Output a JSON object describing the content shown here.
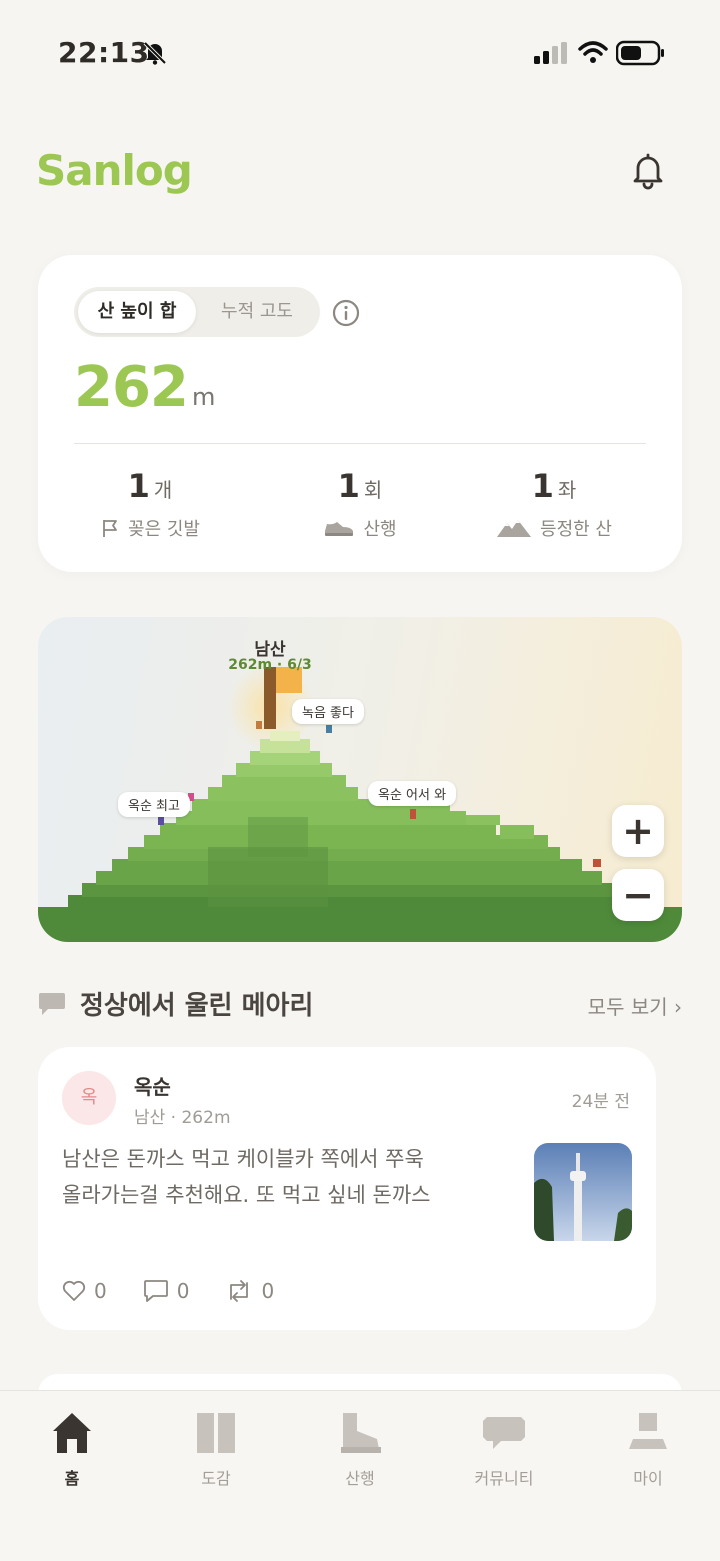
{
  "status_bar": {
    "time": "22:13"
  },
  "header": {
    "app_title": "Sanlog",
    "notification_icon": "bell-icon"
  },
  "stats": {
    "segment_active": "산 높이 합",
    "segment_inactive": "누적 고도",
    "total_value": "262",
    "total_unit": "m",
    "items": [
      {
        "value": "1",
        "unit": "개",
        "label": "꽂은 깃발",
        "icon": "flag-icon"
      },
      {
        "value": "1",
        "unit": "회",
        "label": "산행",
        "icon": "shoe-icon"
      },
      {
        "value": "1",
        "unit": "좌",
        "label": "등정한 산",
        "icon": "mountain-icon"
      }
    ]
  },
  "mountain": {
    "peak_name": "남산",
    "peak_meta": "262m · 6/3",
    "bubbles": [
      "녹음 좋다",
      "옥순 최고",
      "옥순 어서 와"
    ],
    "zoom_in": "+",
    "zoom_out": "−",
    "colors": {
      "grass_light": "#8cc160",
      "grass_mid": "#6aa448",
      "grass_dark": "#4f8a3a",
      "flag": "#f4b24a"
    }
  },
  "memos_section": {
    "title": "정상에서 울린 메아리",
    "see_all": "모두 보기 ›"
  },
  "memo": {
    "avatar_text": "옥",
    "author": "옥순",
    "sub": "남산 · 262m",
    "time": "24분 전",
    "text_line1": "남산은 돈까스 먹고 케이블카 쪽에서 쭈욱",
    "text_line2": "올라가는걸 추천해요. 또 먹고 싶네 돈까스",
    "likes": "0",
    "comments": "0",
    "reposts": "0"
  },
  "tabs": [
    {
      "label": "홈",
      "icon": "home-icon",
      "active": true
    },
    {
      "label": "도감",
      "icon": "book-icon",
      "active": false
    },
    {
      "label": "산행",
      "icon": "boot-icon",
      "active": false
    },
    {
      "label": "커뮤니티",
      "icon": "chat-icon",
      "active": false
    },
    {
      "label": "마이",
      "icon": "person-icon",
      "active": false
    }
  ]
}
